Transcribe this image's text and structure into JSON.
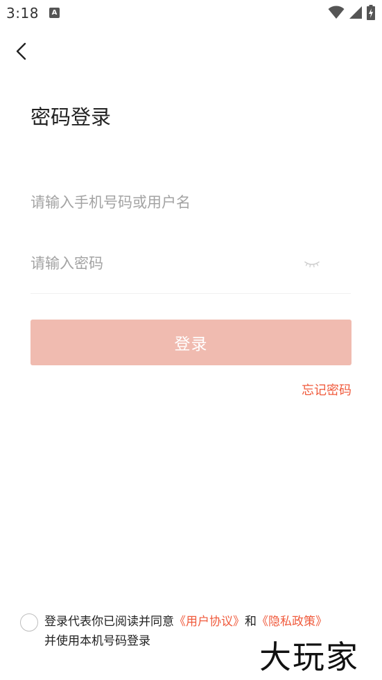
{
  "status_bar": {
    "time": "3:18",
    "notification_icon": "A"
  },
  "icons": {
    "back": "chevron-left-icon",
    "wifi": "wifi-icon",
    "signal": "signal-icon",
    "battery": "battery-charging-icon",
    "eye": "eye-closed-icon"
  },
  "page": {
    "title": "密码登录"
  },
  "form": {
    "username_placeholder": "请输入手机号码或用户名",
    "username_value": "",
    "password_placeholder": "请输入密码",
    "password_value": "",
    "login_label": "登录",
    "forgot_label": "忘记密码"
  },
  "agreement": {
    "prefix": "登录代表你已阅读并同意",
    "user_agreement": "《用户协议》",
    "connector": "和",
    "privacy_policy": "《隐私政策》",
    "suffix": "并使用本机号码登录",
    "checked": false
  },
  "watermark": {
    "text": "大玩家"
  },
  "colors": {
    "accent": "#f05a3c",
    "button_disabled": "#f0bbb0",
    "placeholder": "#a3a3a3"
  }
}
